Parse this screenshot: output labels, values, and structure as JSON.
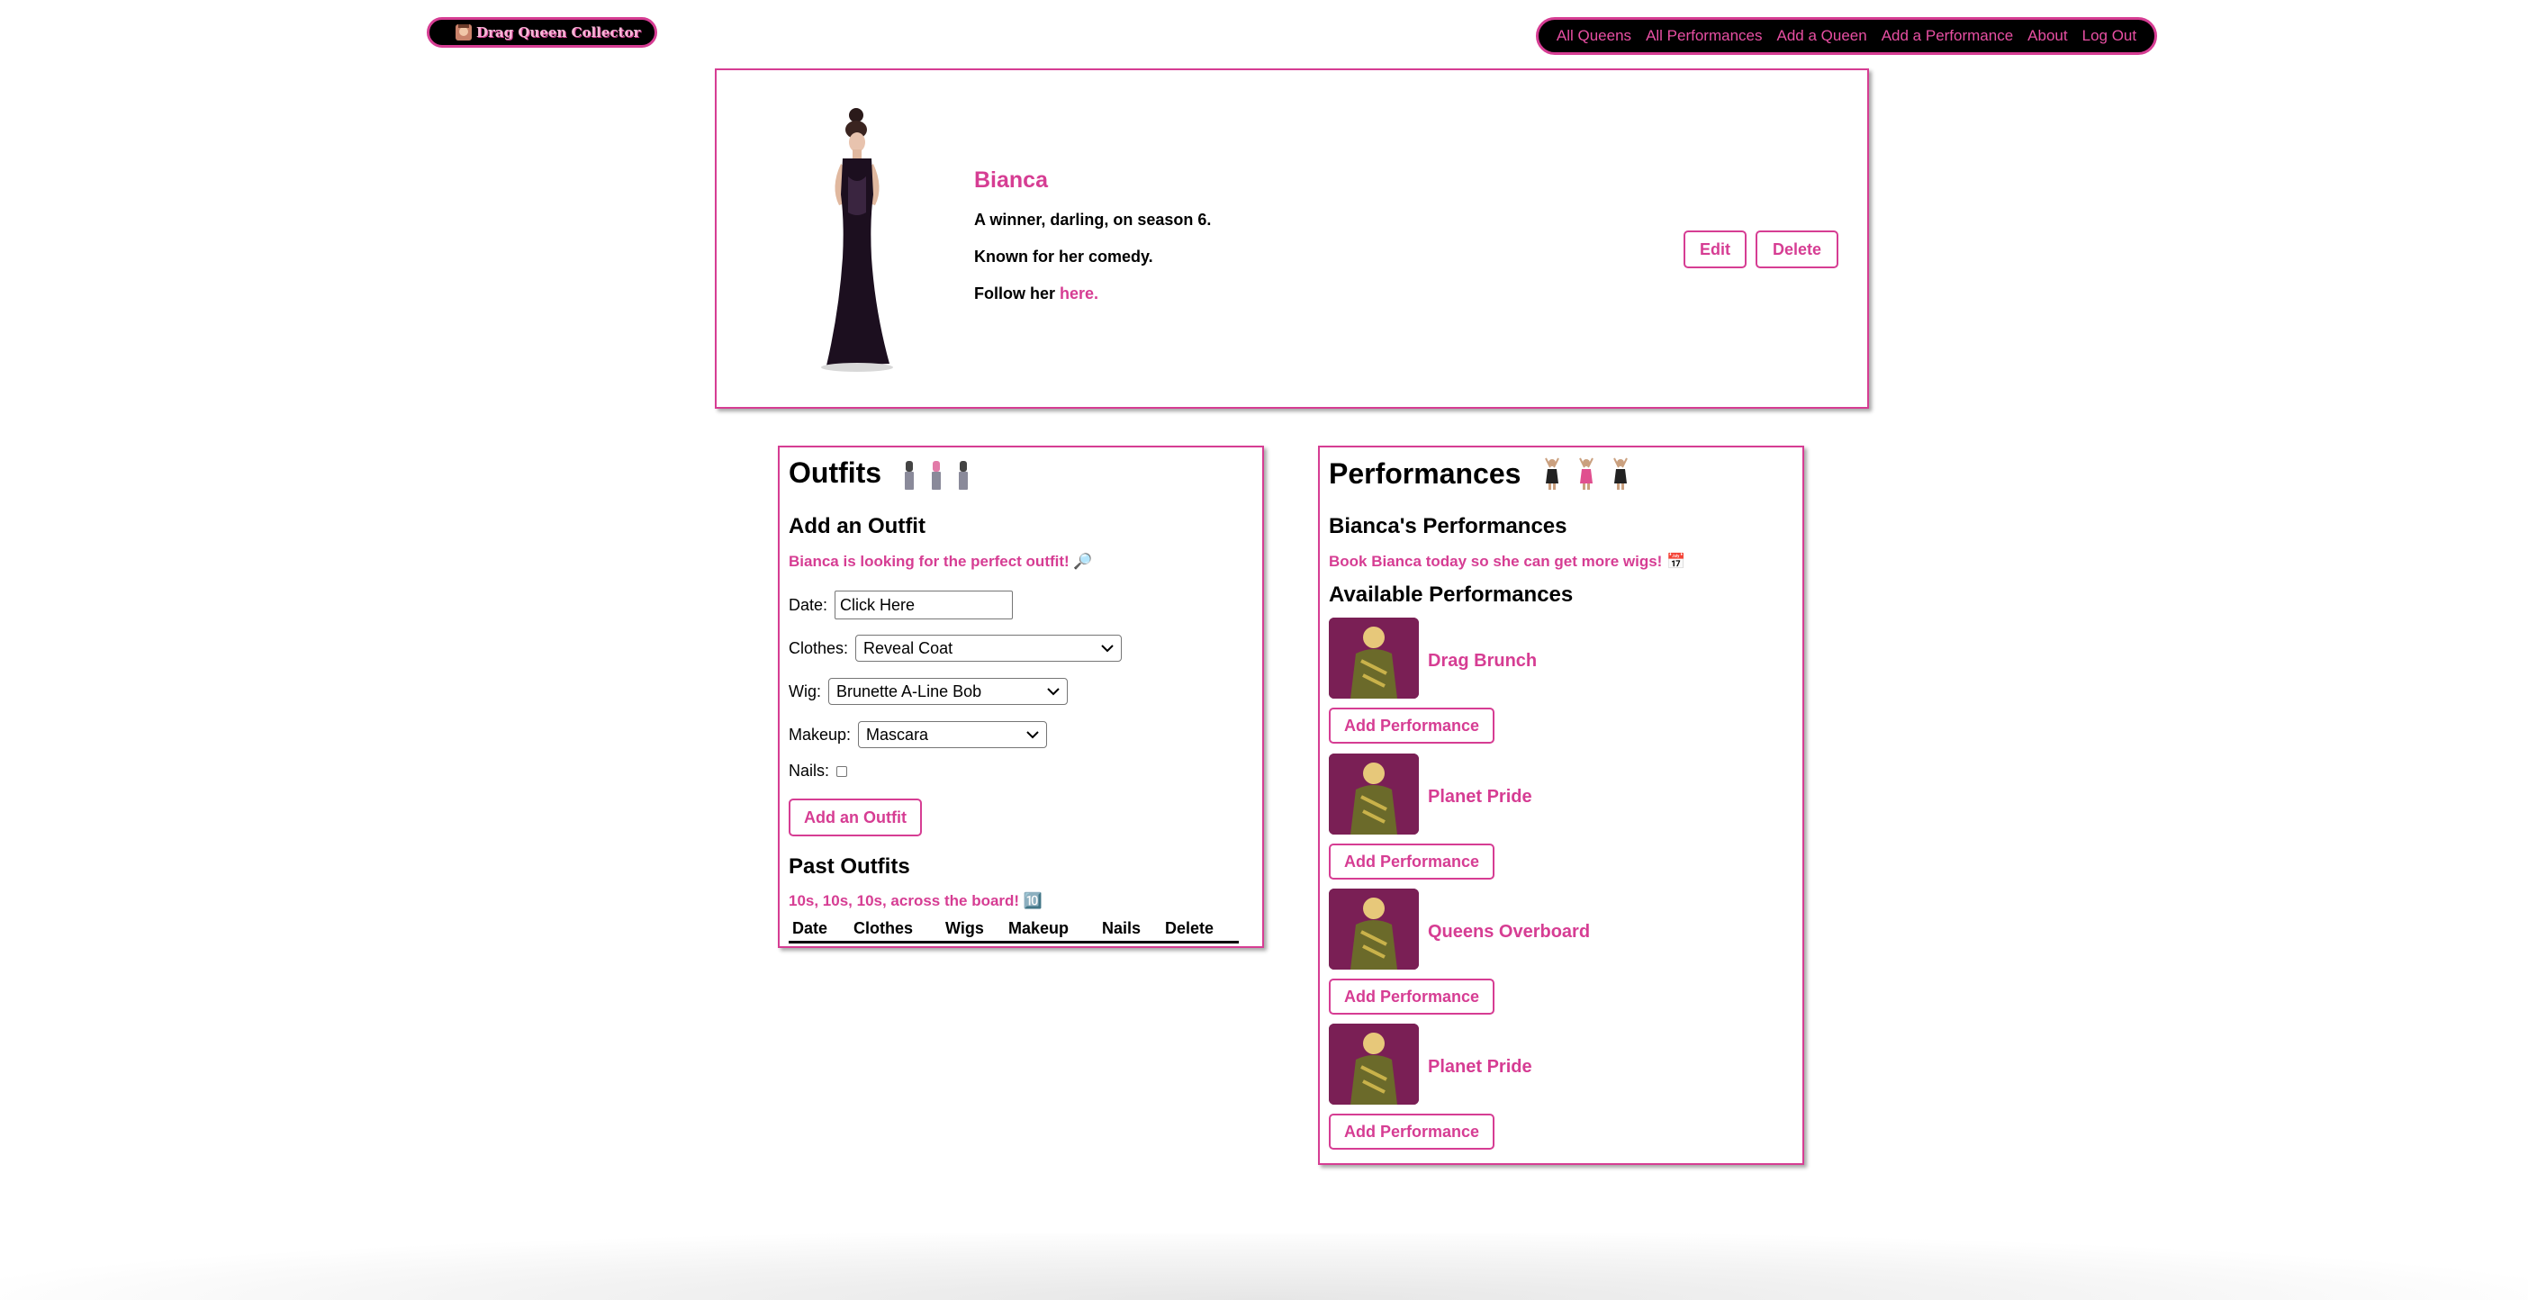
{
  "nav": {
    "brand": "Drag Queen Collector",
    "links": [
      "All Queens",
      "All Performances",
      "Add a Queen",
      "Add a Performance",
      "About",
      "Log Out"
    ]
  },
  "queen": {
    "name": "Bianca",
    "line1": "A winner, darling, on season 6.",
    "line2": "Known for her comedy.",
    "follow_prefix": "Follow her ",
    "follow_link": "here.",
    "edit_label": "Edit",
    "delete_label": "Delete"
  },
  "outfits": {
    "title": "Outfits",
    "add_heading": "Add an Outfit",
    "add_sub": "Bianca is looking for the perfect outfit! 🔎",
    "date_label": "Date:",
    "date_value": "Click Here",
    "clothes_label": "Clothes:",
    "clothes_value": "Reveal Coat",
    "wig_label": "Wig:",
    "wig_value": "Brunette A-Line Bob",
    "makeup_label": "Makeup:",
    "makeup_value": "Mascara",
    "nails_label": "Nails:",
    "add_button": "Add an Outfit",
    "past_heading": "Past Outfits",
    "past_sub": "10s, 10s, 10s, across the board! 🔟",
    "columns": [
      "Date",
      "Clothes",
      "Wigs",
      "Makeup",
      "Nails",
      "Delete"
    ]
  },
  "performances": {
    "title": "Performances",
    "queen_heading": "Bianca's Performances",
    "queen_sub": "Book Bianca today so she can get more wigs! 📅",
    "available_heading": "Available Performances",
    "add_label": "Add Performance",
    "items": [
      {
        "name": "Drag Brunch"
      },
      {
        "name": "Planet Pride"
      },
      {
        "name": "Queens Overboard"
      },
      {
        "name": "Planet Pride"
      }
    ]
  },
  "colors": {
    "accent": "#d63d93",
    "nav_bg": "#000000"
  }
}
